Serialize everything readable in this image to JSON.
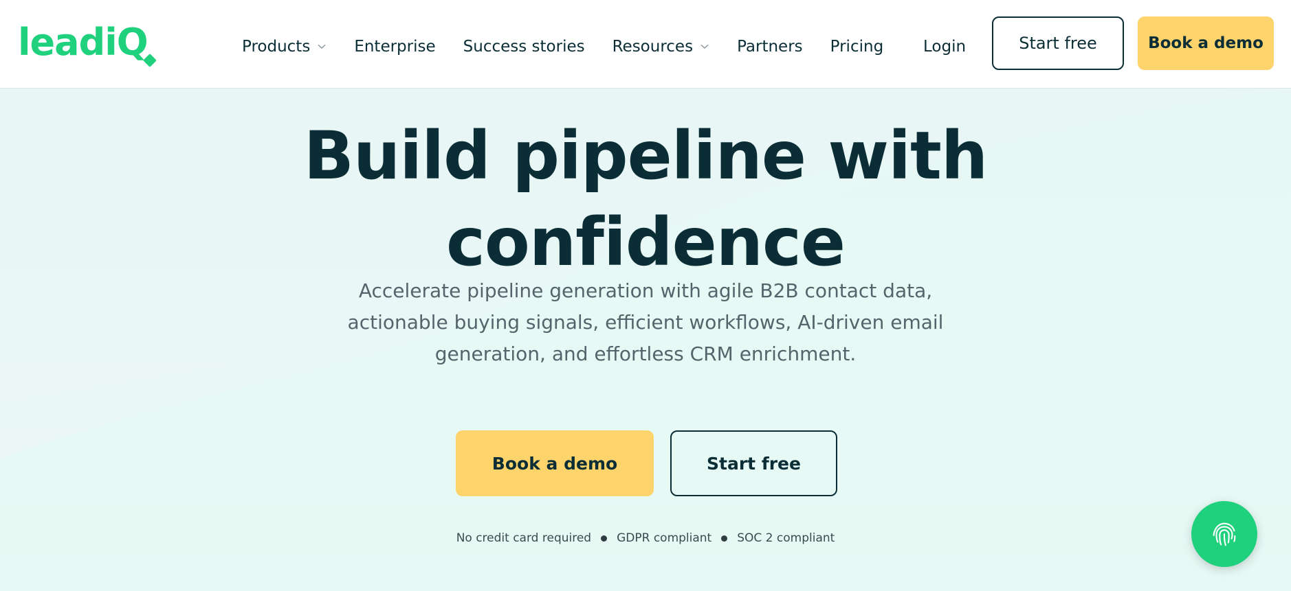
{
  "header": {
    "logo_text_main": "leadi",
    "logo_text_q": "Q",
    "nav": [
      {
        "label": "Products",
        "has_dropdown": true
      },
      {
        "label": "Enterprise",
        "has_dropdown": false
      },
      {
        "label": "Success stories",
        "has_dropdown": false
      },
      {
        "label": "Resources",
        "has_dropdown": true
      },
      {
        "label": "Partners",
        "has_dropdown": false
      },
      {
        "label": "Pricing",
        "has_dropdown": false
      }
    ],
    "login_label": "Login",
    "start_free_label": "Start free",
    "book_demo_label": "Book a demo"
  },
  "hero": {
    "headline_line1": "Build pipeline with",
    "headline_line2": "confidence",
    "subtitle": "Accelerate pipeline generation with agile B2B contact data, actionable buying signals, efficient workflows, AI-driven email generation, and effortless CRM enrichment.",
    "book_demo_label": "Book a demo",
    "start_free_label": "Start free",
    "assurances": [
      "No credit card required",
      "GDPR compliant",
      "SOC 2 compliant"
    ]
  },
  "widgets": {
    "fingerprint_icon": "fingerprint-icon"
  },
  "colors": {
    "brand_green": "#1fd07c",
    "dark_navy": "#0b2e36",
    "cta_yellow": "#fdd36b",
    "hero_bg": "#e4f6f3"
  }
}
